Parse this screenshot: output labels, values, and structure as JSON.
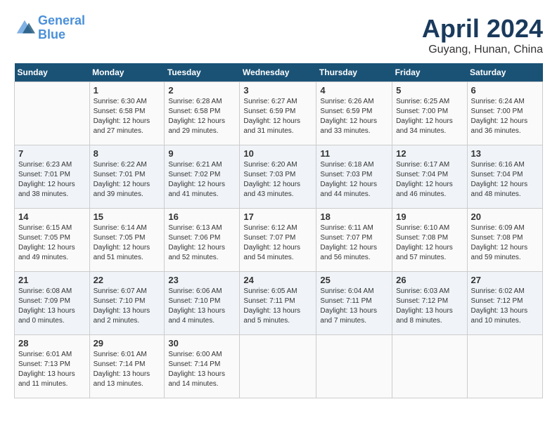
{
  "header": {
    "logo_line1": "General",
    "logo_line2": "Blue",
    "month": "April 2024",
    "location": "Guyang, Hunan, China"
  },
  "weekdays": [
    "Sunday",
    "Monday",
    "Tuesday",
    "Wednesday",
    "Thursday",
    "Friday",
    "Saturday"
  ],
  "weeks": [
    [
      {
        "day": "",
        "info": ""
      },
      {
        "day": "1",
        "info": "Sunrise: 6:30 AM\nSunset: 6:58 PM\nDaylight: 12 hours\nand 27 minutes."
      },
      {
        "day": "2",
        "info": "Sunrise: 6:28 AM\nSunset: 6:58 PM\nDaylight: 12 hours\nand 29 minutes."
      },
      {
        "day": "3",
        "info": "Sunrise: 6:27 AM\nSunset: 6:59 PM\nDaylight: 12 hours\nand 31 minutes."
      },
      {
        "day": "4",
        "info": "Sunrise: 6:26 AM\nSunset: 6:59 PM\nDaylight: 12 hours\nand 33 minutes."
      },
      {
        "day": "5",
        "info": "Sunrise: 6:25 AM\nSunset: 7:00 PM\nDaylight: 12 hours\nand 34 minutes."
      },
      {
        "day": "6",
        "info": "Sunrise: 6:24 AM\nSunset: 7:00 PM\nDaylight: 12 hours\nand 36 minutes."
      }
    ],
    [
      {
        "day": "7",
        "info": "Sunrise: 6:23 AM\nSunset: 7:01 PM\nDaylight: 12 hours\nand 38 minutes."
      },
      {
        "day": "8",
        "info": "Sunrise: 6:22 AM\nSunset: 7:01 PM\nDaylight: 12 hours\nand 39 minutes."
      },
      {
        "day": "9",
        "info": "Sunrise: 6:21 AM\nSunset: 7:02 PM\nDaylight: 12 hours\nand 41 minutes."
      },
      {
        "day": "10",
        "info": "Sunrise: 6:20 AM\nSunset: 7:03 PM\nDaylight: 12 hours\nand 43 minutes."
      },
      {
        "day": "11",
        "info": "Sunrise: 6:18 AM\nSunset: 7:03 PM\nDaylight: 12 hours\nand 44 minutes."
      },
      {
        "day": "12",
        "info": "Sunrise: 6:17 AM\nSunset: 7:04 PM\nDaylight: 12 hours\nand 46 minutes."
      },
      {
        "day": "13",
        "info": "Sunrise: 6:16 AM\nSunset: 7:04 PM\nDaylight: 12 hours\nand 48 minutes."
      }
    ],
    [
      {
        "day": "14",
        "info": "Sunrise: 6:15 AM\nSunset: 7:05 PM\nDaylight: 12 hours\nand 49 minutes."
      },
      {
        "day": "15",
        "info": "Sunrise: 6:14 AM\nSunset: 7:05 PM\nDaylight: 12 hours\nand 51 minutes."
      },
      {
        "day": "16",
        "info": "Sunrise: 6:13 AM\nSunset: 7:06 PM\nDaylight: 12 hours\nand 52 minutes."
      },
      {
        "day": "17",
        "info": "Sunrise: 6:12 AM\nSunset: 7:07 PM\nDaylight: 12 hours\nand 54 minutes."
      },
      {
        "day": "18",
        "info": "Sunrise: 6:11 AM\nSunset: 7:07 PM\nDaylight: 12 hours\nand 56 minutes."
      },
      {
        "day": "19",
        "info": "Sunrise: 6:10 AM\nSunset: 7:08 PM\nDaylight: 12 hours\nand 57 minutes."
      },
      {
        "day": "20",
        "info": "Sunrise: 6:09 AM\nSunset: 7:08 PM\nDaylight: 12 hours\nand 59 minutes."
      }
    ],
    [
      {
        "day": "21",
        "info": "Sunrise: 6:08 AM\nSunset: 7:09 PM\nDaylight: 13 hours\nand 0 minutes."
      },
      {
        "day": "22",
        "info": "Sunrise: 6:07 AM\nSunset: 7:10 PM\nDaylight: 13 hours\nand 2 minutes."
      },
      {
        "day": "23",
        "info": "Sunrise: 6:06 AM\nSunset: 7:10 PM\nDaylight: 13 hours\nand 4 minutes."
      },
      {
        "day": "24",
        "info": "Sunrise: 6:05 AM\nSunset: 7:11 PM\nDaylight: 13 hours\nand 5 minutes."
      },
      {
        "day": "25",
        "info": "Sunrise: 6:04 AM\nSunset: 7:11 PM\nDaylight: 13 hours\nand 7 minutes."
      },
      {
        "day": "26",
        "info": "Sunrise: 6:03 AM\nSunset: 7:12 PM\nDaylight: 13 hours\nand 8 minutes."
      },
      {
        "day": "27",
        "info": "Sunrise: 6:02 AM\nSunset: 7:12 PM\nDaylight: 13 hours\nand 10 minutes."
      }
    ],
    [
      {
        "day": "28",
        "info": "Sunrise: 6:01 AM\nSunset: 7:13 PM\nDaylight: 13 hours\nand 11 minutes."
      },
      {
        "day": "29",
        "info": "Sunrise: 6:01 AM\nSunset: 7:14 PM\nDaylight: 13 hours\nand 13 minutes."
      },
      {
        "day": "30",
        "info": "Sunrise: 6:00 AM\nSunset: 7:14 PM\nDaylight: 13 hours\nand 14 minutes."
      },
      {
        "day": "",
        "info": ""
      },
      {
        "day": "",
        "info": ""
      },
      {
        "day": "",
        "info": ""
      },
      {
        "day": "",
        "info": ""
      }
    ]
  ]
}
